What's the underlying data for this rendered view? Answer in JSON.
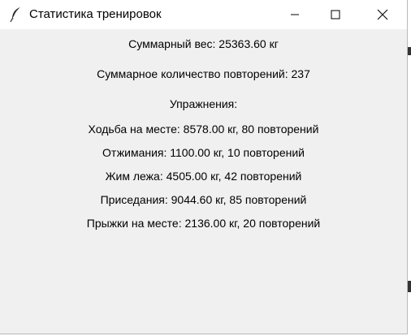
{
  "window": {
    "title": "Статистика тренировок"
  },
  "summary": {
    "total_weight": "Суммарный вес: 25363.60 кг",
    "total_reps": "Суммарное количество повторений: 237",
    "exercises_heading": "Упражнения:"
  },
  "exercises": [
    {
      "text": "Ходьба на месте: 8578.00 кг, 80 повторений"
    },
    {
      "text": "Отжимания: 1100.00 кг, 10 повторений"
    },
    {
      "text": "Жим лежа: 4505.00 кг, 42 повторений"
    },
    {
      "text": "Приседания: 9044.60 кг, 85 повторений"
    },
    {
      "text": "Прыжки на месте: 2136.00 кг, 20 повторений"
    }
  ],
  "icons": {
    "app": "feather-icon",
    "minimize": "minimize-icon",
    "maximize": "maximize-icon",
    "close": "close-icon"
  }
}
